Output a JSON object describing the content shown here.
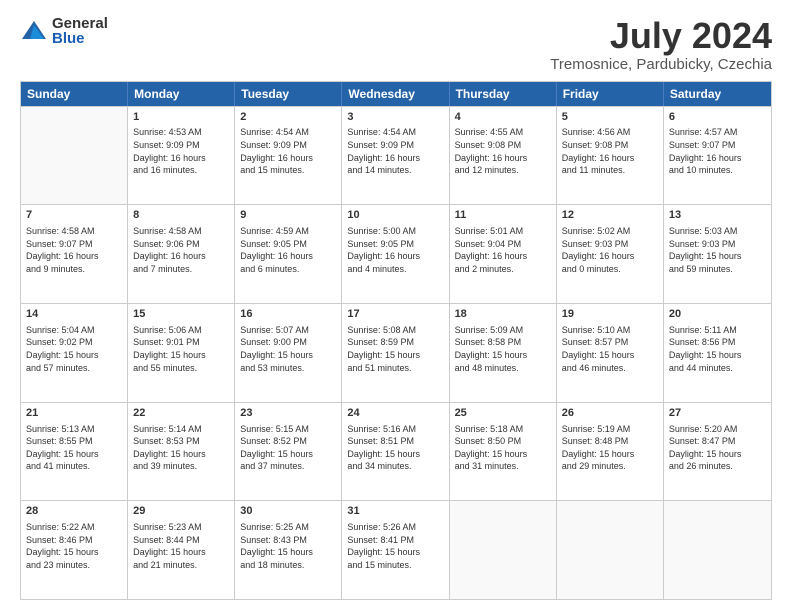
{
  "logo": {
    "general": "General",
    "blue": "Blue"
  },
  "title": {
    "month": "July 2024",
    "location": "Tremosnice, Pardubicky, Czechia"
  },
  "header_days": [
    "Sunday",
    "Monday",
    "Tuesday",
    "Wednesday",
    "Thursday",
    "Friday",
    "Saturday"
  ],
  "rows": [
    [
      {
        "day": "",
        "text": "",
        "empty": true
      },
      {
        "day": "1",
        "text": "Sunrise: 4:53 AM\nSunset: 9:09 PM\nDaylight: 16 hours\nand 16 minutes."
      },
      {
        "day": "2",
        "text": "Sunrise: 4:54 AM\nSunset: 9:09 PM\nDaylight: 16 hours\nand 15 minutes."
      },
      {
        "day": "3",
        "text": "Sunrise: 4:54 AM\nSunset: 9:09 PM\nDaylight: 16 hours\nand 14 minutes."
      },
      {
        "day": "4",
        "text": "Sunrise: 4:55 AM\nSunset: 9:08 PM\nDaylight: 16 hours\nand 12 minutes."
      },
      {
        "day": "5",
        "text": "Sunrise: 4:56 AM\nSunset: 9:08 PM\nDaylight: 16 hours\nand 11 minutes."
      },
      {
        "day": "6",
        "text": "Sunrise: 4:57 AM\nSunset: 9:07 PM\nDaylight: 16 hours\nand 10 minutes."
      }
    ],
    [
      {
        "day": "7",
        "text": "Sunrise: 4:58 AM\nSunset: 9:07 PM\nDaylight: 16 hours\nand 9 minutes."
      },
      {
        "day": "8",
        "text": "Sunrise: 4:58 AM\nSunset: 9:06 PM\nDaylight: 16 hours\nand 7 minutes."
      },
      {
        "day": "9",
        "text": "Sunrise: 4:59 AM\nSunset: 9:05 PM\nDaylight: 16 hours\nand 6 minutes."
      },
      {
        "day": "10",
        "text": "Sunrise: 5:00 AM\nSunset: 9:05 PM\nDaylight: 16 hours\nand 4 minutes."
      },
      {
        "day": "11",
        "text": "Sunrise: 5:01 AM\nSunset: 9:04 PM\nDaylight: 16 hours\nand 2 minutes."
      },
      {
        "day": "12",
        "text": "Sunrise: 5:02 AM\nSunset: 9:03 PM\nDaylight: 16 hours\nand 0 minutes."
      },
      {
        "day": "13",
        "text": "Sunrise: 5:03 AM\nSunset: 9:03 PM\nDaylight: 15 hours\nand 59 minutes."
      }
    ],
    [
      {
        "day": "14",
        "text": "Sunrise: 5:04 AM\nSunset: 9:02 PM\nDaylight: 15 hours\nand 57 minutes."
      },
      {
        "day": "15",
        "text": "Sunrise: 5:06 AM\nSunset: 9:01 PM\nDaylight: 15 hours\nand 55 minutes."
      },
      {
        "day": "16",
        "text": "Sunrise: 5:07 AM\nSunset: 9:00 PM\nDaylight: 15 hours\nand 53 minutes."
      },
      {
        "day": "17",
        "text": "Sunrise: 5:08 AM\nSunset: 8:59 PM\nDaylight: 15 hours\nand 51 minutes."
      },
      {
        "day": "18",
        "text": "Sunrise: 5:09 AM\nSunset: 8:58 PM\nDaylight: 15 hours\nand 48 minutes."
      },
      {
        "day": "19",
        "text": "Sunrise: 5:10 AM\nSunset: 8:57 PM\nDaylight: 15 hours\nand 46 minutes."
      },
      {
        "day": "20",
        "text": "Sunrise: 5:11 AM\nSunset: 8:56 PM\nDaylight: 15 hours\nand 44 minutes."
      }
    ],
    [
      {
        "day": "21",
        "text": "Sunrise: 5:13 AM\nSunset: 8:55 PM\nDaylight: 15 hours\nand 41 minutes."
      },
      {
        "day": "22",
        "text": "Sunrise: 5:14 AM\nSunset: 8:53 PM\nDaylight: 15 hours\nand 39 minutes."
      },
      {
        "day": "23",
        "text": "Sunrise: 5:15 AM\nSunset: 8:52 PM\nDaylight: 15 hours\nand 37 minutes."
      },
      {
        "day": "24",
        "text": "Sunrise: 5:16 AM\nSunset: 8:51 PM\nDaylight: 15 hours\nand 34 minutes."
      },
      {
        "day": "25",
        "text": "Sunrise: 5:18 AM\nSunset: 8:50 PM\nDaylight: 15 hours\nand 31 minutes."
      },
      {
        "day": "26",
        "text": "Sunrise: 5:19 AM\nSunset: 8:48 PM\nDaylight: 15 hours\nand 29 minutes."
      },
      {
        "day": "27",
        "text": "Sunrise: 5:20 AM\nSunset: 8:47 PM\nDaylight: 15 hours\nand 26 minutes."
      }
    ],
    [
      {
        "day": "28",
        "text": "Sunrise: 5:22 AM\nSunset: 8:46 PM\nDaylight: 15 hours\nand 23 minutes."
      },
      {
        "day": "29",
        "text": "Sunrise: 5:23 AM\nSunset: 8:44 PM\nDaylight: 15 hours\nand 21 minutes."
      },
      {
        "day": "30",
        "text": "Sunrise: 5:25 AM\nSunset: 8:43 PM\nDaylight: 15 hours\nand 18 minutes."
      },
      {
        "day": "31",
        "text": "Sunrise: 5:26 AM\nSunset: 8:41 PM\nDaylight: 15 hours\nand 15 minutes."
      },
      {
        "day": "",
        "text": "",
        "empty": true
      },
      {
        "day": "",
        "text": "",
        "empty": true
      },
      {
        "day": "",
        "text": "",
        "empty": true
      }
    ]
  ]
}
